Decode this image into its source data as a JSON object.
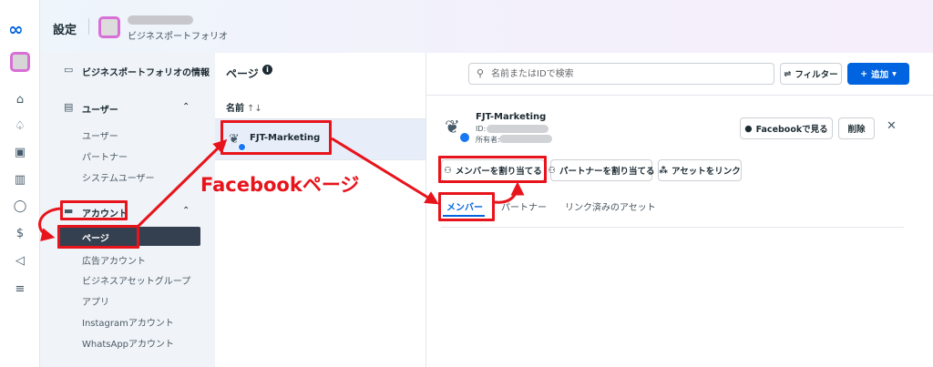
{
  "header": {
    "title": "設定",
    "portfolio_label": "ビジネスポートフォリオ"
  },
  "rail": {
    "icons": [
      "meta-logo-icon",
      "home-icon",
      "bell-icon",
      "inbox-icon",
      "chart-icon",
      "chat-icon",
      "dollar-icon",
      "megaphone-icon",
      "menu-icon"
    ],
    "brand_glyph": "∞"
  },
  "sidebar": {
    "info": "ビジネスポートフォリオの情報",
    "users_section": "ユーザー",
    "users_items": [
      "ユーザー",
      "パートナー",
      "システムユーザー"
    ],
    "accounts_section": "アカウント",
    "accounts_items": [
      "ページ",
      "広告アカウント",
      "ビジネスアセットグループ",
      "アプリ",
      "Instagramアカウント",
      "WhatsAppアカウント"
    ]
  },
  "list": {
    "heading": "ページ",
    "column_name": "名前",
    "sort_glyph": "↑↓",
    "page_name": "FJT-Marketing"
  },
  "toolbar": {
    "search_placeholder": "名前またはIDで検索",
    "filter_label": "フィルター",
    "add_label": "追加"
  },
  "detail": {
    "page_name": "FJT-Marketing",
    "id_label": "ID:",
    "owner_label": "所有者:",
    "view_fb_label": "Facebookで見る",
    "delete_label": "削除",
    "assign_member_label": "メンバーを割り当てる",
    "assign_partner_label": "パートナーを割り当てる",
    "link_asset_label": "アセットをリンク",
    "tabs": [
      "メンバー",
      "パートナー",
      "リンク済みのアセット"
    ]
  },
  "annotation": {
    "text": "Facebookページ",
    "color": "#e8141c"
  },
  "colors": {
    "accent": "#0064e0",
    "sidebar_active": "#344050",
    "selected_row": "#e7eef9"
  }
}
